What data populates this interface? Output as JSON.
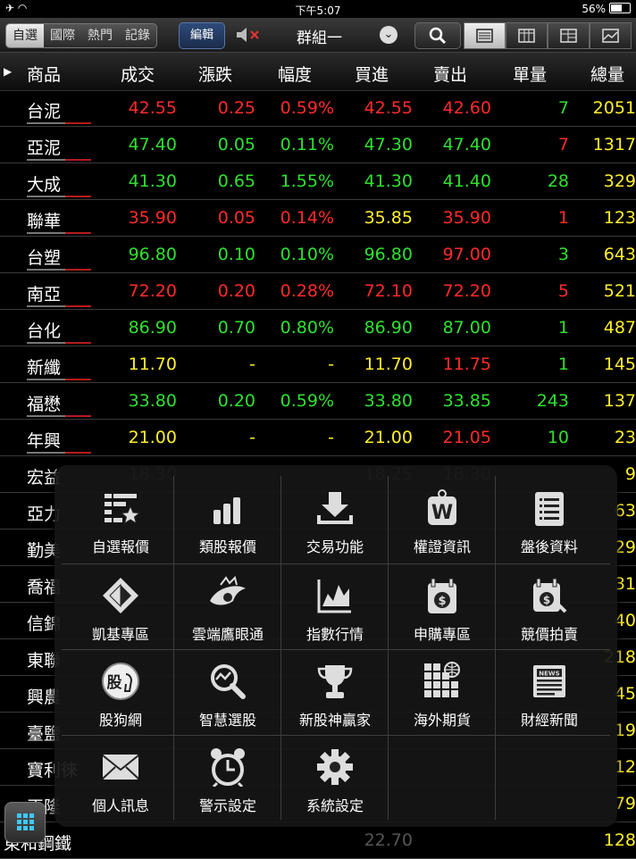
{
  "status": {
    "time": "下午5:07",
    "battery": "56%"
  },
  "toolbar": {
    "tabs": [
      "自選",
      "國際",
      "熱門",
      "記錄"
    ],
    "edit_label": "編輯",
    "group_label": "群組一"
  },
  "table": {
    "headers": [
      "商品",
      "成交",
      "漲跌",
      "幅度",
      "買進",
      "賣出",
      "單量",
      "總量"
    ],
    "rows": [
      {
        "name": "台泥",
        "price": "42.55",
        "chg": "0.25",
        "pct": "0.59%",
        "bid": "42.55",
        "ask": "42.60",
        "vol": "7",
        "total": "2051",
        "c": [
          "red",
          "red",
          "red",
          "red",
          "red",
          "green",
          "yellow"
        ]
      },
      {
        "name": "亞泥",
        "price": "47.40",
        "chg": "0.05",
        "pct": "0.11%",
        "bid": "47.30",
        "ask": "47.40",
        "vol": "7",
        "total": "1317",
        "c": [
          "green",
          "green",
          "green",
          "green",
          "green",
          "red",
          "yellow"
        ]
      },
      {
        "name": "大成",
        "price": "41.30",
        "chg": "0.65",
        "pct": "1.55%",
        "bid": "41.30",
        "ask": "41.40",
        "vol": "28",
        "total": "329",
        "c": [
          "green",
          "green",
          "green",
          "green",
          "green",
          "green",
          "yellow"
        ]
      },
      {
        "name": "聯華",
        "price": "35.90",
        "chg": "0.05",
        "pct": "0.14%",
        "bid": "35.85",
        "ask": "35.90",
        "vol": "1",
        "total": "123",
        "c": [
          "red",
          "red",
          "red",
          "yellow",
          "red",
          "red",
          "yellow"
        ]
      },
      {
        "name": "台塑",
        "price": "96.80",
        "chg": "0.10",
        "pct": "0.10%",
        "bid": "96.80",
        "ask": "97.00",
        "vol": "3",
        "total": "643",
        "c": [
          "green",
          "green",
          "green",
          "green",
          "red",
          "green",
          "yellow"
        ]
      },
      {
        "name": "南亞",
        "price": "72.20",
        "chg": "0.20",
        "pct": "0.28%",
        "bid": "72.10",
        "ask": "72.20",
        "vol": "5",
        "total": "521",
        "c": [
          "red",
          "red",
          "red",
          "red",
          "red",
          "red",
          "yellow"
        ]
      },
      {
        "name": "台化",
        "price": "86.90",
        "chg": "0.70",
        "pct": "0.80%",
        "bid": "86.90",
        "ask": "87.00",
        "vol": "1",
        "total": "487",
        "c": [
          "green",
          "green",
          "green",
          "green",
          "green",
          "green",
          "yellow"
        ]
      },
      {
        "name": "新纖",
        "price": "11.70",
        "chg": "-",
        "pct": "-",
        "bid": "11.70",
        "ask": "11.75",
        "vol": "1",
        "total": "145",
        "c": [
          "yellow",
          "yellow",
          "yellow",
          "yellow",
          "red",
          "green",
          "yellow"
        ]
      },
      {
        "name": "福懋",
        "price": "33.80",
        "chg": "0.20",
        "pct": "0.59%",
        "bid": "33.80",
        "ask": "33.85",
        "vol": "243",
        "total": "137",
        "c": [
          "green",
          "green",
          "green",
          "green",
          "green",
          "green",
          "yellow"
        ]
      },
      {
        "name": "年興",
        "price": "21.00",
        "chg": "-",
        "pct": "-",
        "bid": "21.00",
        "ask": "21.05",
        "vol": "10",
        "total": "23",
        "c": [
          "yellow",
          "yellow",
          "yellow",
          "yellow",
          "red",
          "green",
          "yellow"
        ]
      }
    ],
    "hidden_rows": [
      {
        "name": "宏益",
        "price": "18.30",
        "bid": "18.25",
        "ask": "18.30",
        "total": "9"
      },
      {
        "name": "亞力",
        "total": "63"
      },
      {
        "name": "勤美",
        "total": "29"
      },
      {
        "name": "喬福",
        "total": "31"
      },
      {
        "name": "信錦",
        "total": "40"
      },
      {
        "name": "東聯",
        "total": "218"
      },
      {
        "name": "興農",
        "total": "45"
      },
      {
        "name": "臺鹽",
        "total": "19"
      },
      {
        "name": "寶利徠",
        "total": "12"
      },
      {
        "name": "正隆",
        "total": "79"
      },
      {
        "name": "東和鋼鐵",
        "bid": "22.70",
        "total": "128"
      }
    ]
  },
  "menu": {
    "items": [
      "自選報價",
      "類股報價",
      "交易功能",
      "權證資訊",
      "盤後資料",
      "凱基專區",
      "雲端鷹眼通",
      "指數行情",
      "申購專區",
      "競價拍賣",
      "股狗網",
      "智慧選股",
      "新股神贏家",
      "海外期貨",
      "財經新聞",
      "個人訊息",
      "警示設定",
      "系統設定"
    ],
    "icons": [
      "star-list-icon",
      "bar-chart-icon",
      "download-arrow-icon",
      "warrant-w-icon",
      "list-doc-icon",
      "kgi-logo-icon",
      "eagle-eye-icon",
      "index-chart-icon",
      "dollar-calendar-icon",
      "auction-calendar-icon",
      "stock-dog-icon",
      "smart-pick-icon",
      "trophy-icon",
      "globe-grid-icon",
      "news-icon",
      "mail-icon",
      "alarm-clock-icon",
      "gear-icon"
    ],
    "logo_text": "股",
    "news_text": "NEWS",
    "warrant_text": "W"
  },
  "colors": {
    "red": "#ff2a2a",
    "green": "#2fe12f",
    "yellow": "#ffef2c"
  }
}
